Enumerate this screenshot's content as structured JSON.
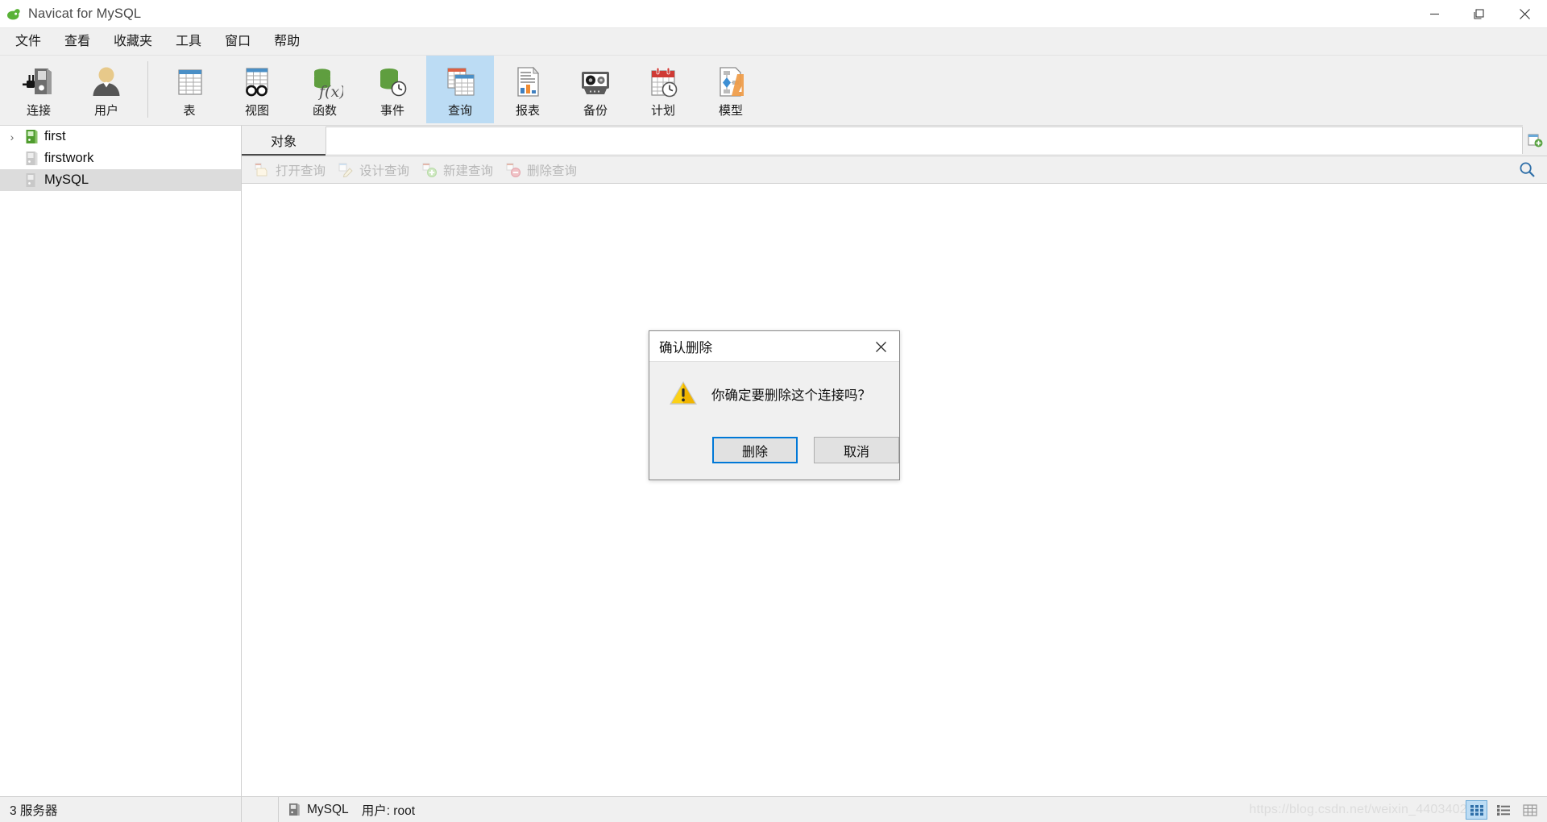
{
  "window": {
    "title": "Navicat for MySQL",
    "app_icon": "navicat-logo-icon",
    "minimize_label": "─",
    "maximize_label": "❐",
    "close_label": "✕"
  },
  "menubar": {
    "items": [
      {
        "label": "文件",
        "name": "menu-file"
      },
      {
        "label": "查看",
        "name": "menu-view"
      },
      {
        "label": "收藏夹",
        "name": "menu-favorites"
      },
      {
        "label": "工具",
        "name": "menu-tools"
      },
      {
        "label": "窗口",
        "name": "menu-window"
      },
      {
        "label": "帮助",
        "name": "menu-help"
      }
    ]
  },
  "toolbar": {
    "groups": [
      [
        {
          "label": "连接",
          "icon": "connection-icon",
          "name": "toolbar-connection",
          "active": false
        },
        {
          "label": "用户",
          "icon": "user-icon",
          "name": "toolbar-user",
          "active": false
        }
      ],
      [
        {
          "label": "表",
          "icon": "table-icon",
          "name": "toolbar-table",
          "active": false
        },
        {
          "label": "视图",
          "icon": "view-icon",
          "name": "toolbar-view",
          "active": false
        },
        {
          "label": "函数",
          "icon": "function-icon",
          "name": "toolbar-function",
          "active": false
        },
        {
          "label": "事件",
          "icon": "event-icon",
          "name": "toolbar-event",
          "active": false
        },
        {
          "label": "查询",
          "icon": "query-icon",
          "name": "toolbar-query",
          "active": true
        },
        {
          "label": "报表",
          "icon": "report-icon",
          "name": "toolbar-report",
          "active": false
        },
        {
          "label": "备份",
          "icon": "backup-icon",
          "name": "toolbar-backup",
          "active": false
        },
        {
          "label": "计划",
          "icon": "schedule-icon",
          "name": "toolbar-schedule",
          "active": false
        },
        {
          "label": "模型",
          "icon": "model-icon",
          "name": "toolbar-model",
          "active": false
        }
      ]
    ]
  },
  "sidebar": {
    "items": [
      {
        "label": "first",
        "icon": "server-green-icon",
        "name": "sidebar-item-first",
        "expandable": true,
        "twisty": "›",
        "selected": false
      },
      {
        "label": "firstwork",
        "icon": "server-gray-icon",
        "name": "sidebar-item-firstwork",
        "expandable": false,
        "twisty": "",
        "selected": false
      },
      {
        "label": "MySQL",
        "icon": "server-gray-icon",
        "name": "sidebar-item-mysql",
        "expandable": false,
        "twisty": "",
        "selected": true
      }
    ]
  },
  "tabs": {
    "items": [
      {
        "label": "对象",
        "name": "tab-objects",
        "active": true
      }
    ],
    "add_icon": "add-tab-icon"
  },
  "subtoolbar": {
    "buttons": [
      {
        "label": "打开查询",
        "icon": "open-query-icon",
        "name": "open-query-button"
      },
      {
        "label": "设计查询",
        "icon": "design-query-icon",
        "name": "design-query-button"
      },
      {
        "label": "新建查询",
        "icon": "new-query-icon",
        "name": "new-query-button"
      },
      {
        "label": "删除查询",
        "icon": "delete-query-icon",
        "name": "delete-query-button"
      }
    ],
    "search_icon": "search-icon"
  },
  "statusbar": {
    "server_count": "3 服务器",
    "connection_icon": "server-gray-icon",
    "connection_name": "MySQL",
    "user_label": "用户: root",
    "watermark": "https://blog.csdn.net/weixin_44034024",
    "view_buttons": [
      {
        "icon": "grid-view-icon",
        "name": "grid-view-button",
        "active": true
      },
      {
        "icon": "detail-view-icon",
        "name": "detail-view-button",
        "active": false
      },
      {
        "icon": "list-view-icon",
        "name": "list-view-button",
        "active": false
      }
    ]
  },
  "dialog": {
    "title": "确认删除",
    "close_label": "✕",
    "warning_icon": "warning-triangle-icon",
    "message": "你确定要删除这个连接吗？",
    "confirm_label": "删除",
    "cancel_label": "取消"
  },
  "colors": {
    "accent": "#0078d7",
    "toolbar_active_bg": "#bcdcf4",
    "chrome_bg": "#f0f0f0",
    "selection_bg": "#dcdcdc",
    "green": "#5a9e3a",
    "warning_yellow": "#f7d117"
  }
}
